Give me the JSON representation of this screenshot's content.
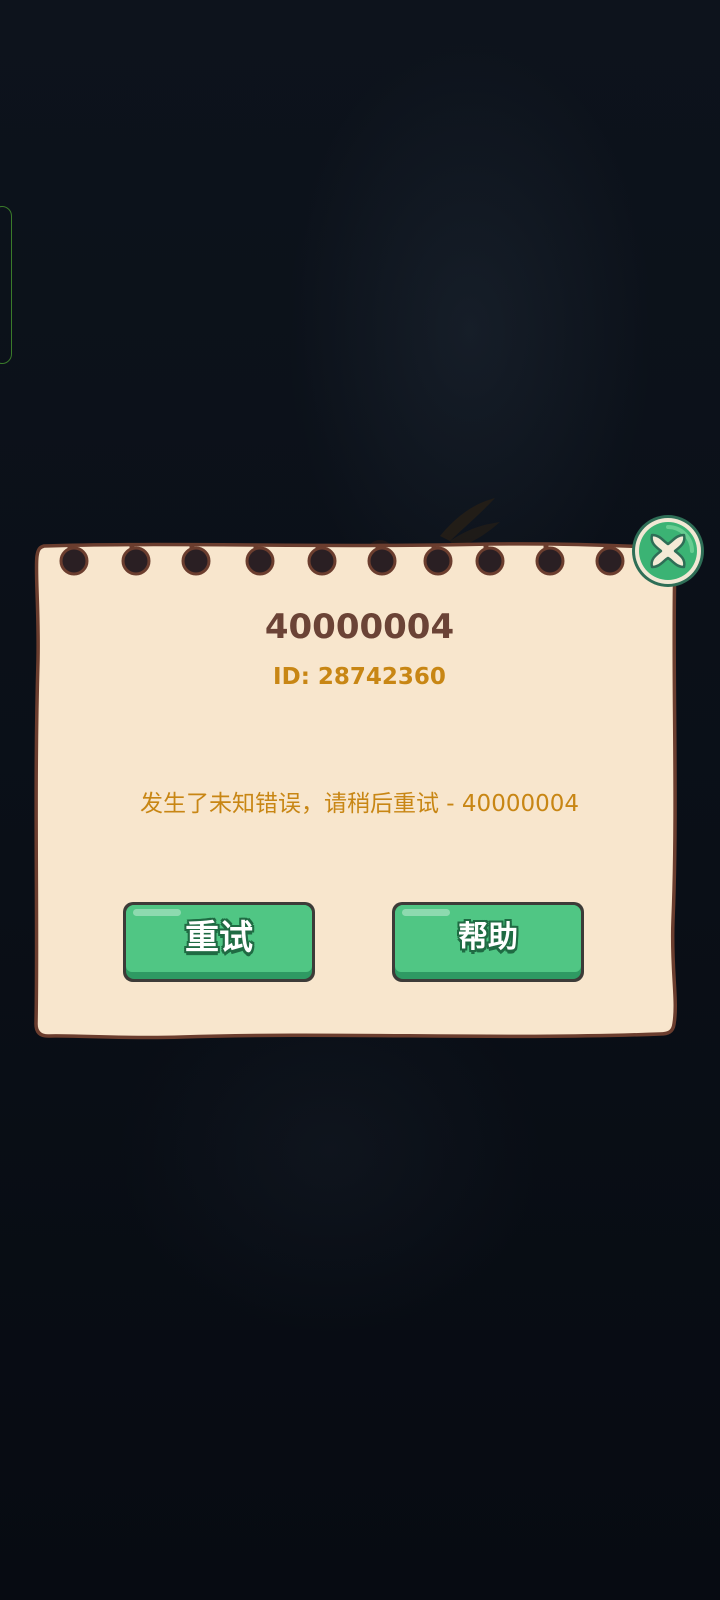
{
  "dialog": {
    "error_code": "40000004",
    "error_id": "ID: 28742360",
    "message": "发生了未知错误，请稍后重试 - 40000004",
    "retry_label": "重试",
    "help_label": "帮助",
    "close_icon": "close-x-icon"
  },
  "colors": {
    "background": "#0a0f17",
    "paper": "#f8e6cd",
    "paper_border": "#6b3d2e",
    "code_text": "#6b4336",
    "accent_text": "#c88614",
    "button_green": "#50c684",
    "button_shadow": "#2e9a63"
  }
}
